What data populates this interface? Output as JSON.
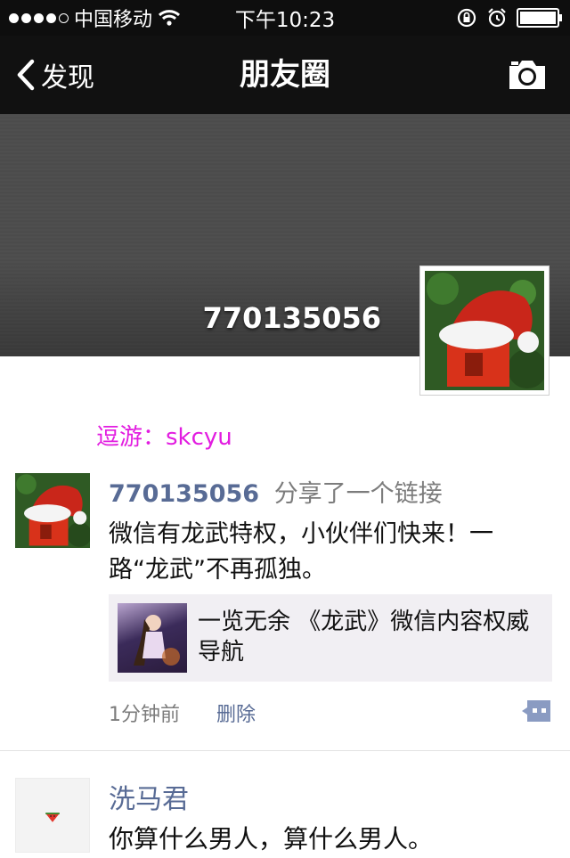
{
  "status_bar": {
    "carrier": "中国移动",
    "time": "下午10:23"
  },
  "nav": {
    "back_label": "发现",
    "title": "朋友圈"
  },
  "profile": {
    "name": "770135056"
  },
  "promo_text": "逗游：skcyu",
  "post": {
    "user": "770135056",
    "action": "分享了一个链接",
    "text": "微信有龙武特权，小伙伴们快来！一路“龙武”不再孤独。",
    "link_title": "一览无余 《龙武》微信内容权威导航",
    "time": "1分钟前",
    "delete_label": "删除"
  },
  "post2": {
    "user": "洗马君",
    "text": "你算什么男人，算什么男人。"
  },
  "colors": {
    "name_blue": "#586b95",
    "promo_magenta": "#e21ce0",
    "bar_dark": "#111111"
  }
}
